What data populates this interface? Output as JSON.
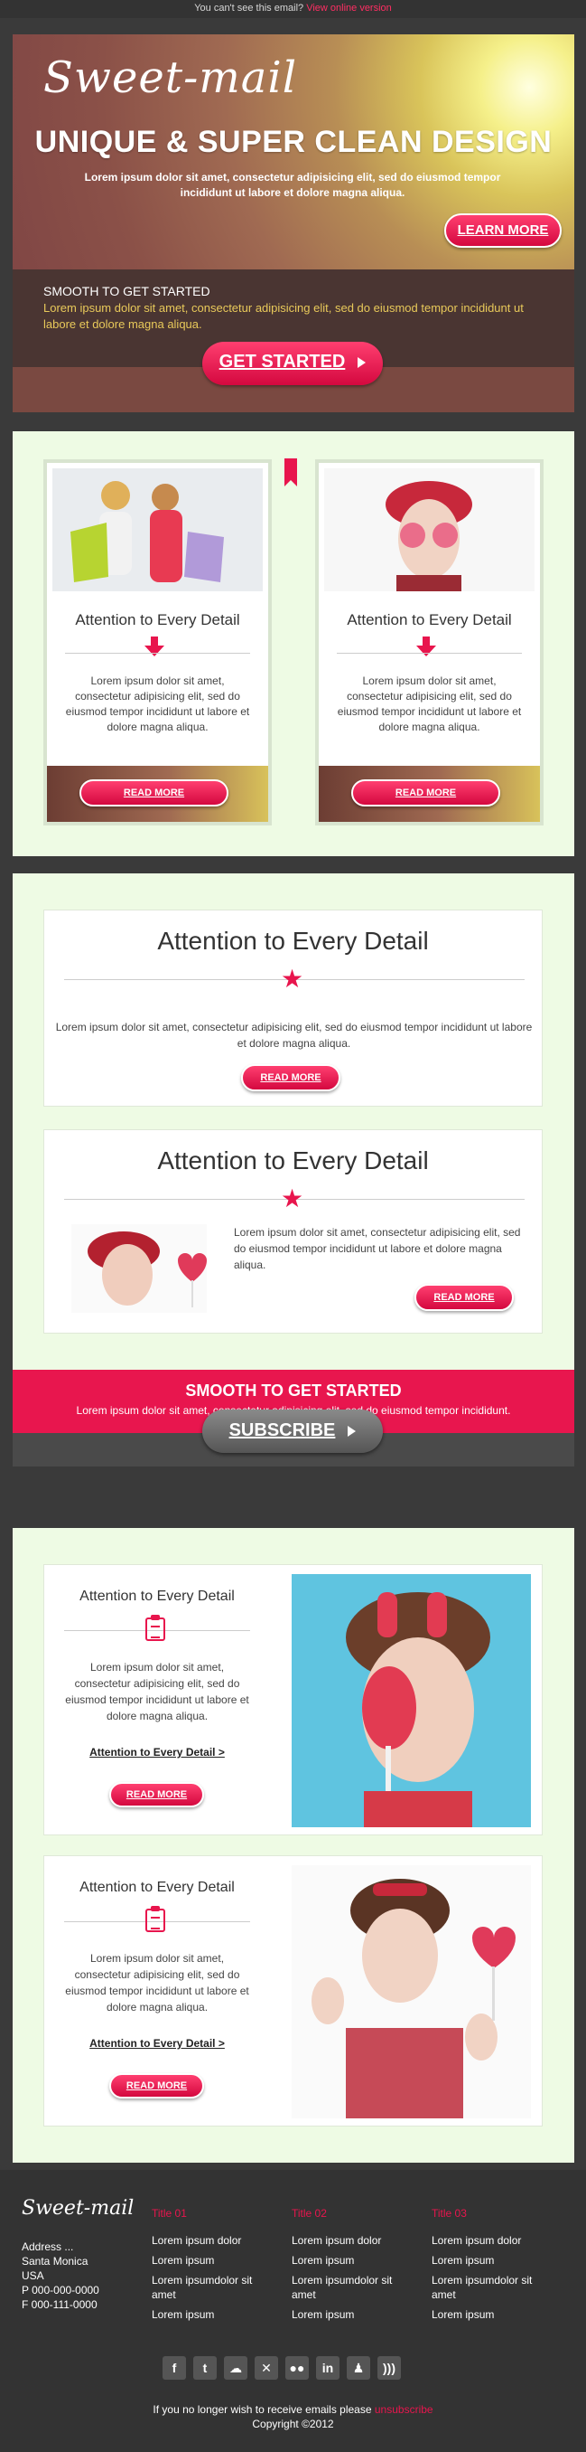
{
  "topbar": {
    "text": "You can't see this email?",
    "link": "View online version"
  },
  "hero": {
    "logo": "Sweet-mail",
    "headline": "UNIQUE & SUPER CLEAN DESIGN",
    "sub": "Lorem ipsum dolor sit amet, consectetur adipisicing elit, sed do eiusmod tempor incididunt ut labore et dolore magna aliqua.",
    "learn_more": "LEARN MORE",
    "smooth_title": "SMOOTH TO GET STARTED",
    "smooth_text": "Lorem ipsum dolor sit amet, consectetur adipisicing elit, sed do eiusmod tempor incididunt ut labore et dolore magna aliqua.",
    "get_started": "GET STARTED"
  },
  "section1": {
    "cards": [
      {
        "title": "Attention to Every Detail",
        "body": "Lorem ipsum dolor sit amet, consectetur adipisicing elit, sed do eiusmod tempor incididunt ut labore et dolore magna aliqua.",
        "button": "READ MORE"
      },
      {
        "title": "Attention to Every Detail",
        "body": "Lorem ipsum dolor sit amet, consectetur adipisicing elit, sed do eiusmod tempor incididunt ut labore et dolore magna aliqua.",
        "button": "READ MORE"
      }
    ]
  },
  "section2": {
    "card_a": {
      "title": "Attention to Every Detail",
      "body": "Lorem ipsum dolor sit amet, consectetur adipisicing elit, sed do eiusmod tempor incididunt ut labore et dolore magna aliqua.",
      "button": "READ MORE"
    },
    "card_b": {
      "title": "Attention to Every Detail",
      "body": "Lorem ipsum dolor sit amet, consectetur adipisicing elit, sed do eiusmod tempor incididunt ut labore et dolore magna aliqua.",
      "button": "READ MORE"
    },
    "band_title": "SMOOTH TO GET STARTED",
    "band_text": "Lorem ipsum dolor sit amet, consectetur adipisicing elit, sed do eiusmod tempor incididunt.",
    "subscribe": "SUBSCRIBE"
  },
  "section3": {
    "cards": [
      {
        "title": "Attention to Every Detail",
        "body": "Lorem ipsum dolor sit amet, consectetur adipisicing elit, sed do eiusmod tempor incididunt ut labore et dolore magna aliqua.",
        "link": "Attention to Every Detail >",
        "button": "READ MORE"
      },
      {
        "title": "Attention to Every Detail",
        "body": "Lorem ipsum dolor sit amet, consectetur adipisicing elit, sed do eiusmod tempor incididunt ut labore et dolore magna aliqua.",
        "link": "Attention to Every Detail >",
        "button": "READ MORE"
      }
    ]
  },
  "footer": {
    "logo": "Sweet-mail",
    "address": [
      "Address ...",
      "Santa Monica",
      "USA",
      "P 000-000-0000",
      "F 000-111-0000"
    ],
    "columns": [
      {
        "title": "Title 01",
        "items": [
          "Lorem ipsum dolor",
          "Lorem ipsum",
          "Lorem ipsumdolor sit amet",
          "Lorem ipsum"
        ]
      },
      {
        "title": "Title 02",
        "items": [
          "Lorem ipsum dolor",
          "Lorem ipsum",
          "Lorem ipsumdolor sit amet",
          "Lorem ipsum"
        ]
      },
      {
        "title": "Title 03",
        "items": [
          "Lorem ipsum dolor",
          "Lorem ipsum",
          "Lorem ipsumdolor sit amet",
          "Lorem ipsum"
        ]
      }
    ],
    "social_icons": [
      "facebook-icon",
      "twitter-icon",
      "delicious-icon",
      "xing-icon",
      "flickr-icon",
      "linkedin-icon",
      "myspace-icon",
      "rss-icon"
    ],
    "unsub_text": "If you no longer wish to receive emails please",
    "unsub_link": "unsubscribe",
    "copyright": "Copyright ©2012"
  },
  "colors": {
    "accent": "#e8154d",
    "section_bg": "#eefbe4",
    "page_bg": "#3a3a3a"
  }
}
